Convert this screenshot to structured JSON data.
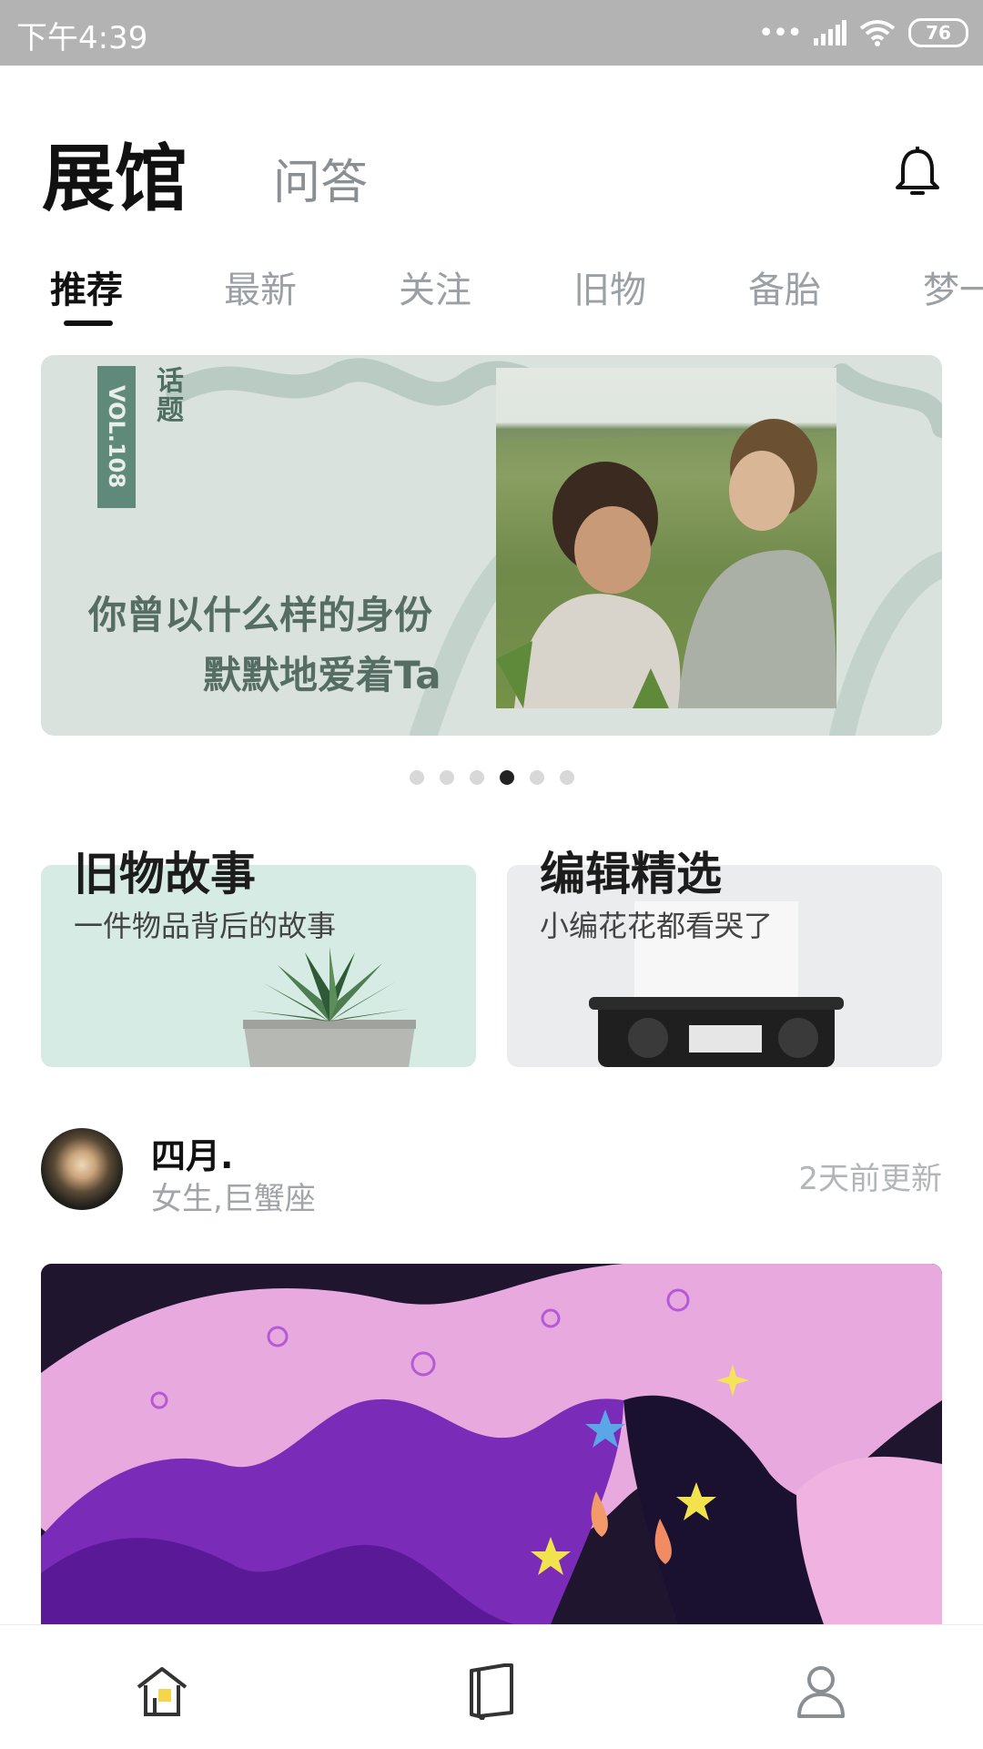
{
  "status_bar": {
    "time": "下午4:39",
    "battery": "76"
  },
  "header": {
    "title": "展馆",
    "secondary_tab": "问答"
  },
  "tabs": [
    {
      "label": "推荐",
      "active": true
    },
    {
      "label": "最新"
    },
    {
      "label": "关注"
    },
    {
      "label": "旧物"
    },
    {
      "label": "备胎"
    },
    {
      "label": "梦一"
    }
  ],
  "banner": {
    "vol": "VOL.108",
    "tag": "话题",
    "line1": "你曾以什么样的身份",
    "line2": "默默地爱着Ta",
    "active_page": 4,
    "page_count": 6
  },
  "features": [
    {
      "title": "旧物故事",
      "subtitle": "一件物品背后的故事",
      "bg": "#d6ebe3"
    },
    {
      "title": "编辑精选",
      "subtitle": "小编花花都看哭了",
      "bg": "#ebeced"
    }
  ],
  "post": {
    "author": "四月.",
    "info": "女生,巨蟹座",
    "updated": "2天前更新"
  },
  "bottom_nav": [
    "home-icon",
    "notebook-icon",
    "profile-icon"
  ],
  "colors": {
    "accent": "#5f8a7b",
    "banner_bg": "#d9e2dd",
    "status_bar": "#b3b3b3"
  }
}
